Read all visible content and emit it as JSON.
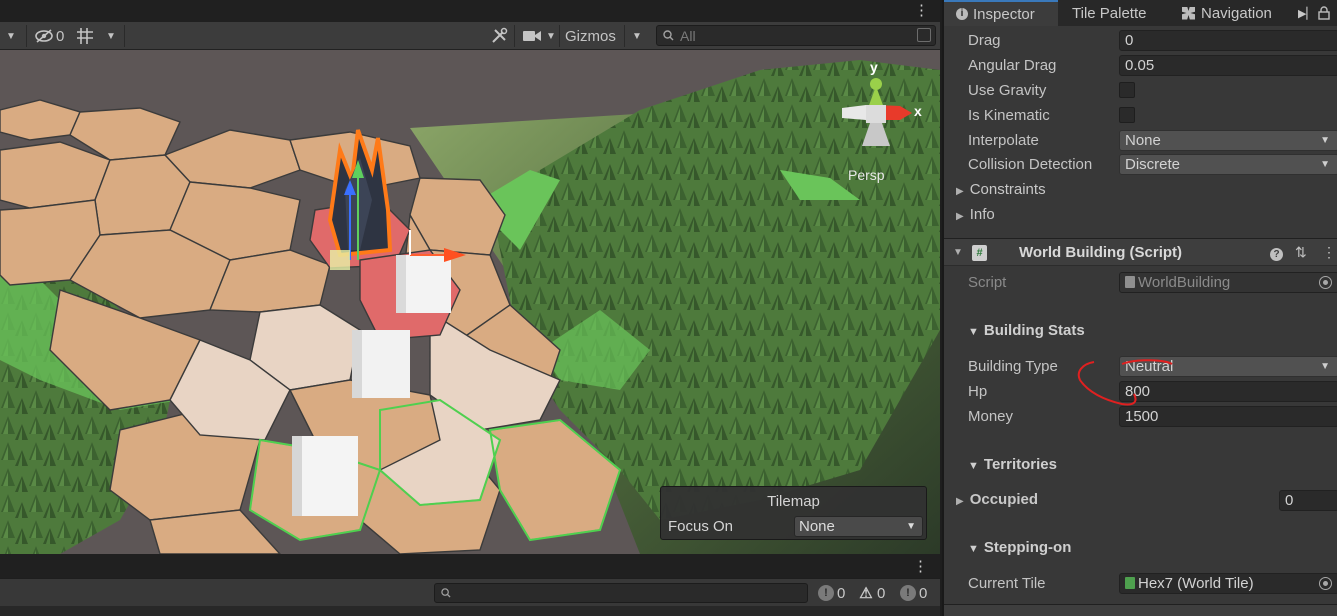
{
  "scene": {
    "toolbar": {
      "hidden_count": "0",
      "gizmos_label": "Gizmos",
      "search_placeholder": "All"
    },
    "orientation": {
      "y_label": "y",
      "x_label": "x",
      "projection_label": "Persp"
    },
    "tilemap_overlay": {
      "title": "Tilemap",
      "focus_label": "Focus On",
      "focus_value": "None"
    }
  },
  "console": {
    "info_count": "0",
    "warning_count": "0",
    "error_count": "0"
  },
  "inspector": {
    "tabs": [
      {
        "label": "Inspector",
        "icon": "info-icon"
      },
      {
        "label": "Tile Palette"
      },
      {
        "label": "Navigation",
        "icon": "navigation-icon"
      }
    ],
    "rigidbody": {
      "drag_label": "Drag",
      "drag_value": "0",
      "angular_drag_label": "Angular Drag",
      "angular_drag_value": "0.05",
      "use_gravity_label": "Use Gravity",
      "is_kinematic_label": "Is Kinematic",
      "interpolate_label": "Interpolate",
      "interpolate_value": "None",
      "collision_label": "Collision Detection",
      "collision_value": "Discrete",
      "constraints_label": "Constraints",
      "info_label": "Info"
    },
    "world_building": {
      "title": "World Building (Script)",
      "script_label": "Script",
      "script_value": "WorldBuilding",
      "stats_header": "Building Stats",
      "building_type_label": "Building Type",
      "building_type_value": "Neutral",
      "hp_label": "Hp",
      "hp_value": "800",
      "money_label": "Money",
      "money_value": "1500",
      "territories_header": "Territories",
      "occupied_label": "Occupied",
      "occupied_value": "0",
      "stepping_header": "Stepping-on",
      "current_tile_label": "Current Tile",
      "current_tile_value": "Hex7 (World Tile)"
    }
  },
  "colors": {
    "accent": "#3a79bb",
    "hex_sand": "#d9ab82",
    "hex_selected": "#e06a6a",
    "grass": "#6ac45a",
    "annotation_red": "#e02020"
  }
}
